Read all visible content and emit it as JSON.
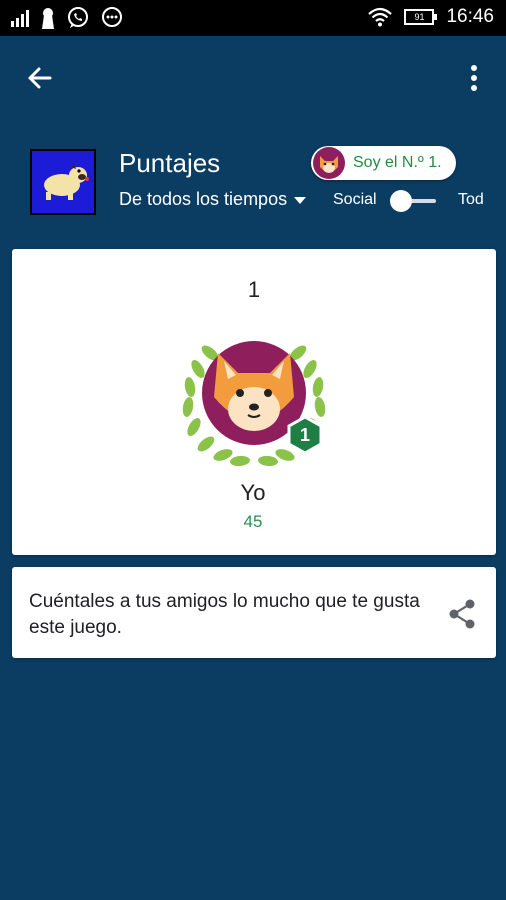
{
  "status_bar": {
    "time": "16:46",
    "battery": "91",
    "icons": [
      "signal-icon",
      "keyhole-icon",
      "whatsapp-icon",
      "chat-icon",
      "wifi-icon",
      "battery-icon"
    ]
  },
  "app_bar": {
    "back_icon": "arrow-back-icon",
    "overflow_icon": "more-vert-icon"
  },
  "header": {
    "title": "Puntajes",
    "time_filter": "De todos los tiempos",
    "social_label": "Social",
    "all_label": "Todos",
    "rank_chip": "Soy el N.º 1."
  },
  "leaderboard": {
    "rank": "1",
    "badge_rank": "1",
    "player_name": "Yo",
    "score": "45"
  },
  "share_card": {
    "text": "Cuéntales a tus amigos lo mucho que te gusta este juego.",
    "share_icon": "share-icon"
  },
  "colors": {
    "background": "#0b3d63",
    "card": "#ffffff",
    "score_green": "#2e8b57",
    "badge_green": "#1e7e44",
    "avatar_bg": "#8e1f5c",
    "game_icon_bg": "#1b1bd8"
  }
}
